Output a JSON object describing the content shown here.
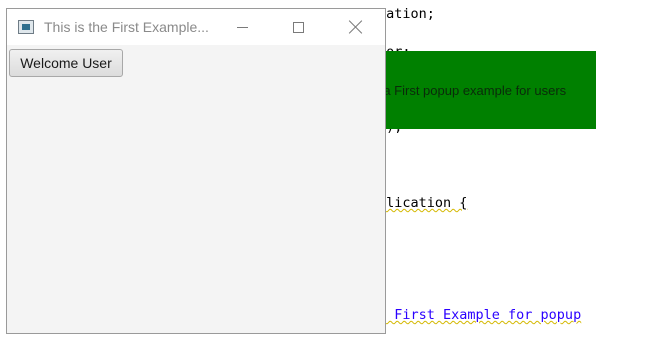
{
  "editor": {
    "lines": [
      "cation;",
      "tor;",
      "e);",
      "plication {",
      "e First Example for popup"
    ]
  },
  "popup": {
    "text": "Its a First popup example for users",
    "color": "#008000"
  },
  "window": {
    "title": "This is the First Example...",
    "app_icon": "java-app-icon",
    "controls": [
      "minimize-icon",
      "maximize-icon",
      "close-icon"
    ],
    "button_label": "Welcome User"
  }
}
